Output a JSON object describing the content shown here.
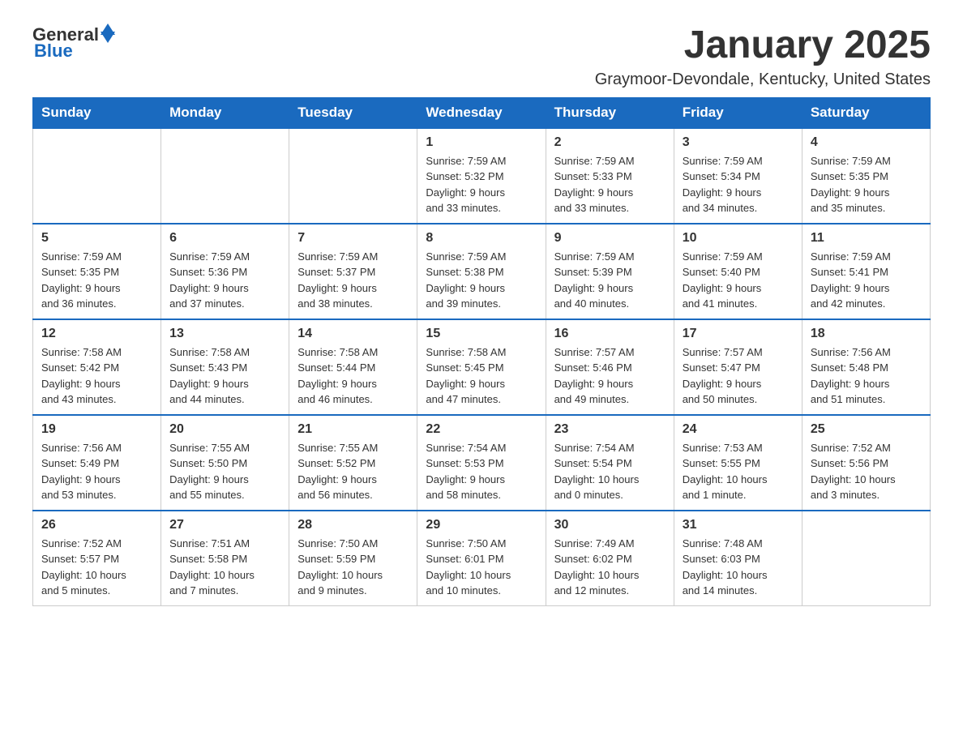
{
  "header": {
    "logo_general": "General",
    "logo_blue": "Blue",
    "month_title": "January 2025",
    "location": "Graymoor-Devondale, Kentucky, United States"
  },
  "weekdays": [
    "Sunday",
    "Monday",
    "Tuesday",
    "Wednesday",
    "Thursday",
    "Friday",
    "Saturday"
  ],
  "weeks": [
    [
      {
        "day": "",
        "info": ""
      },
      {
        "day": "",
        "info": ""
      },
      {
        "day": "",
        "info": ""
      },
      {
        "day": "1",
        "info": "Sunrise: 7:59 AM\nSunset: 5:32 PM\nDaylight: 9 hours\nand 33 minutes."
      },
      {
        "day": "2",
        "info": "Sunrise: 7:59 AM\nSunset: 5:33 PM\nDaylight: 9 hours\nand 33 minutes."
      },
      {
        "day": "3",
        "info": "Sunrise: 7:59 AM\nSunset: 5:34 PM\nDaylight: 9 hours\nand 34 minutes."
      },
      {
        "day": "4",
        "info": "Sunrise: 7:59 AM\nSunset: 5:35 PM\nDaylight: 9 hours\nand 35 minutes."
      }
    ],
    [
      {
        "day": "5",
        "info": "Sunrise: 7:59 AM\nSunset: 5:35 PM\nDaylight: 9 hours\nand 36 minutes."
      },
      {
        "day": "6",
        "info": "Sunrise: 7:59 AM\nSunset: 5:36 PM\nDaylight: 9 hours\nand 37 minutes."
      },
      {
        "day": "7",
        "info": "Sunrise: 7:59 AM\nSunset: 5:37 PM\nDaylight: 9 hours\nand 38 minutes."
      },
      {
        "day": "8",
        "info": "Sunrise: 7:59 AM\nSunset: 5:38 PM\nDaylight: 9 hours\nand 39 minutes."
      },
      {
        "day": "9",
        "info": "Sunrise: 7:59 AM\nSunset: 5:39 PM\nDaylight: 9 hours\nand 40 minutes."
      },
      {
        "day": "10",
        "info": "Sunrise: 7:59 AM\nSunset: 5:40 PM\nDaylight: 9 hours\nand 41 minutes."
      },
      {
        "day": "11",
        "info": "Sunrise: 7:59 AM\nSunset: 5:41 PM\nDaylight: 9 hours\nand 42 minutes."
      }
    ],
    [
      {
        "day": "12",
        "info": "Sunrise: 7:58 AM\nSunset: 5:42 PM\nDaylight: 9 hours\nand 43 minutes."
      },
      {
        "day": "13",
        "info": "Sunrise: 7:58 AM\nSunset: 5:43 PM\nDaylight: 9 hours\nand 44 minutes."
      },
      {
        "day": "14",
        "info": "Sunrise: 7:58 AM\nSunset: 5:44 PM\nDaylight: 9 hours\nand 46 minutes."
      },
      {
        "day": "15",
        "info": "Sunrise: 7:58 AM\nSunset: 5:45 PM\nDaylight: 9 hours\nand 47 minutes."
      },
      {
        "day": "16",
        "info": "Sunrise: 7:57 AM\nSunset: 5:46 PM\nDaylight: 9 hours\nand 49 minutes."
      },
      {
        "day": "17",
        "info": "Sunrise: 7:57 AM\nSunset: 5:47 PM\nDaylight: 9 hours\nand 50 minutes."
      },
      {
        "day": "18",
        "info": "Sunrise: 7:56 AM\nSunset: 5:48 PM\nDaylight: 9 hours\nand 51 minutes."
      }
    ],
    [
      {
        "day": "19",
        "info": "Sunrise: 7:56 AM\nSunset: 5:49 PM\nDaylight: 9 hours\nand 53 minutes."
      },
      {
        "day": "20",
        "info": "Sunrise: 7:55 AM\nSunset: 5:50 PM\nDaylight: 9 hours\nand 55 minutes."
      },
      {
        "day": "21",
        "info": "Sunrise: 7:55 AM\nSunset: 5:52 PM\nDaylight: 9 hours\nand 56 minutes."
      },
      {
        "day": "22",
        "info": "Sunrise: 7:54 AM\nSunset: 5:53 PM\nDaylight: 9 hours\nand 58 minutes."
      },
      {
        "day": "23",
        "info": "Sunrise: 7:54 AM\nSunset: 5:54 PM\nDaylight: 10 hours\nand 0 minutes."
      },
      {
        "day": "24",
        "info": "Sunrise: 7:53 AM\nSunset: 5:55 PM\nDaylight: 10 hours\nand 1 minute."
      },
      {
        "day": "25",
        "info": "Sunrise: 7:52 AM\nSunset: 5:56 PM\nDaylight: 10 hours\nand 3 minutes."
      }
    ],
    [
      {
        "day": "26",
        "info": "Sunrise: 7:52 AM\nSunset: 5:57 PM\nDaylight: 10 hours\nand 5 minutes."
      },
      {
        "day": "27",
        "info": "Sunrise: 7:51 AM\nSunset: 5:58 PM\nDaylight: 10 hours\nand 7 minutes."
      },
      {
        "day": "28",
        "info": "Sunrise: 7:50 AM\nSunset: 5:59 PM\nDaylight: 10 hours\nand 9 minutes."
      },
      {
        "day": "29",
        "info": "Sunrise: 7:50 AM\nSunset: 6:01 PM\nDaylight: 10 hours\nand 10 minutes."
      },
      {
        "day": "30",
        "info": "Sunrise: 7:49 AM\nSunset: 6:02 PM\nDaylight: 10 hours\nand 12 minutes."
      },
      {
        "day": "31",
        "info": "Sunrise: 7:48 AM\nSunset: 6:03 PM\nDaylight: 10 hours\nand 14 minutes."
      },
      {
        "day": "",
        "info": ""
      }
    ]
  ]
}
